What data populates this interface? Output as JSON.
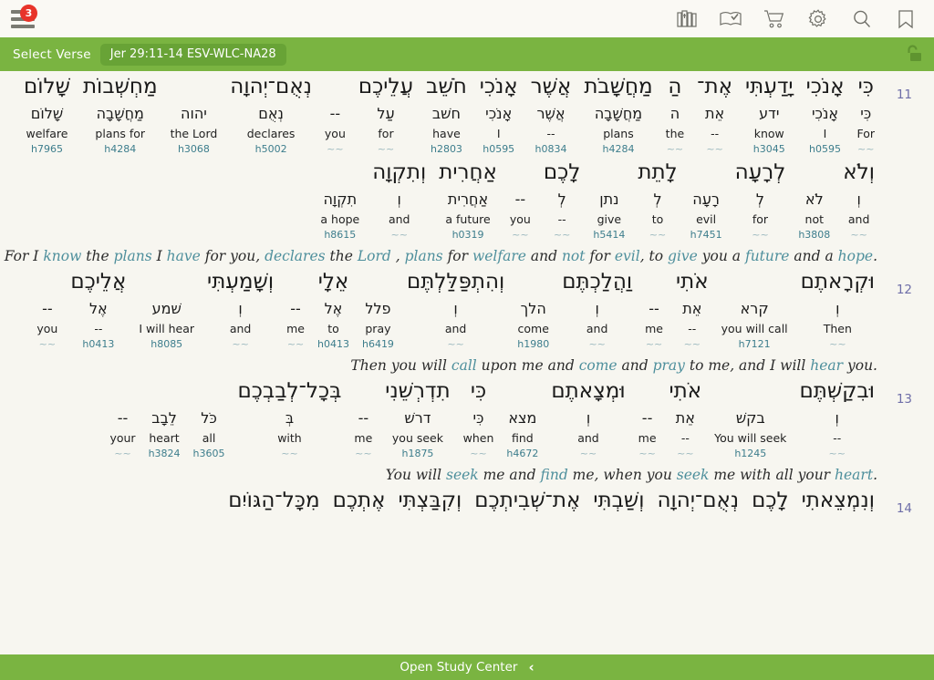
{
  "app": {
    "menu_badge_count": "3",
    "top_icons": [
      {
        "name": "library-books-icon",
        "label": "Library"
      },
      {
        "name": "open-book-check-icon",
        "label": "Reading Plan"
      },
      {
        "name": "shopping-cart-icon",
        "label": "Store"
      },
      {
        "name": "gear-icon",
        "label": "Settings"
      },
      {
        "name": "search-icon",
        "label": "Search"
      },
      {
        "name": "bookmark-icon",
        "label": "Bookmarks"
      }
    ]
  },
  "verse_bar": {
    "select_verse_label": "Select Verse",
    "reference_chip": "Jer 29:11-14 ESV-WLC-NA28",
    "lock_icon": "unlock-icon",
    "bar_color": "#7ab441",
    "chip_color": "#68a336"
  },
  "bottom_bar": {
    "label": "Open Study Center",
    "chevron": "‹"
  },
  "colors": {
    "page_bg": "#f7f6f0",
    "accent_green": "#7ab441",
    "verse_number": "#6e6ea8",
    "strongs": "#3d7d8c",
    "highlight": "#4e8f9c",
    "badge_red": "#e8342a"
  },
  "passage": {
    "verses": [
      {
        "number": "11",
        "rows": [
          {
            "words": [
              {
                "heb": "כִּי",
                "lemma": "כִּי",
                "gloss": "For",
                "strong": "~~"
              },
              {
                "heb": "אָנֹכִי",
                "lemma": "אָנֹכִי",
                "gloss": "I",
                "strong": "h0595"
              },
              {
                "heb": "יָדַעְתִּי",
                "lemma": "ידע",
                "gloss": "know",
                "strong": "h3045"
              },
              {
                "heb": "אֶת־",
                "lemma": "אֵת",
                "gloss": "--",
                "strong": "~~"
              },
              {
                "heb": "הַ",
                "lemma": "ה",
                "gloss": "the",
                "strong": "~~"
              },
              {
                "heb": "מַחֲשָׁבֹת",
                "lemma": "מַחֲשָׁבָה",
                "gloss": "plans",
                "strong": "h4284"
              },
              {
                "heb": "אֲשֶׁר",
                "lemma": "אֲשֶׁר",
                "gloss": "--",
                "strong": "h0834"
              },
              {
                "heb": "אָנֹכִי",
                "lemma": "אָנֹכִי",
                "gloss": "I",
                "strong": "h0595"
              },
              {
                "heb": "חֹשֵׁב",
                "lemma": "חשׁב",
                "gloss": "have",
                "strong": "h2803"
              },
              {
                "heb": "עֲלֵיכֶם",
                "lemma": "עַל",
                "gloss": "for",
                "strong": "~~"
              },
              {
                "heb": "",
                "lemma": "--",
                "gloss": "you",
                "strong": "~~"
              },
              {
                "heb": "נְאֻם־יְהוָה",
                "lemma": "נְאֻם",
                "gloss": "declares",
                "strong": "h5002"
              },
              {
                "heb": "",
                "lemma": "יהוה",
                "gloss": "the Lord",
                "strong": "h3068"
              },
              {
                "heb": "מַחְשְׁבוֹת",
                "lemma": "מַחֲשָׁבָה",
                "gloss": "plans for",
                "strong": "h4284"
              },
              {
                "heb": "שָׁלוֹם",
                "lemma": "שָׁלוֹם",
                "gloss": "welfare",
                "strong": "h7965"
              }
            ]
          },
          {
            "words": [
              {
                "heb": "וְלֹא",
                "lemma": "וְ",
                "gloss": "and",
                "strong": "~~"
              },
              {
                "heb": "",
                "lemma": "לֹא",
                "gloss": "not",
                "strong": "h3808"
              },
              {
                "heb": "לְרָעָה",
                "lemma": "לְ",
                "gloss": "for",
                "strong": "~~"
              },
              {
                "heb": "",
                "lemma": "רָעָה",
                "gloss": "evil",
                "strong": "h7451"
              },
              {
                "heb": "לָתֵת",
                "lemma": "לְ",
                "gloss": "to",
                "strong": "~~"
              },
              {
                "heb": "",
                "lemma": "נתן",
                "gloss": "give",
                "strong": "h5414"
              },
              {
                "heb": "לָכֶם",
                "lemma": "לְ",
                "gloss": "--",
                "strong": "~~"
              },
              {
                "heb": "",
                "lemma": "--",
                "gloss": "you",
                "strong": "~~"
              },
              {
                "heb": "אַחֲרִית",
                "lemma": "אַחֲרִית",
                "gloss": "a future",
                "strong": "h0319"
              },
              {
                "heb": "וְתִקְוָה",
                "lemma": "וְ",
                "gloss": "and",
                "strong": "~~"
              },
              {
                "heb": "",
                "lemma": "תִקְוָה",
                "gloss": "a hope",
                "strong": "h8615"
              }
            ]
          }
        ],
        "translation": [
          {
            "t": "For I ",
            "hl": false
          },
          {
            "t": "know",
            "hl": true
          },
          {
            "t": " the ",
            "hl": false
          },
          {
            "t": "plans",
            "hl": true
          },
          {
            "t": " I ",
            "hl": false
          },
          {
            "t": "have",
            "hl": true
          },
          {
            "t": " for you, ",
            "hl": false
          },
          {
            "t": "declares",
            "hl": true
          },
          {
            "t": " the ",
            "hl": false
          },
          {
            "t": "Lord",
            "hl": true
          },
          {
            "t": " , ",
            "hl": false
          },
          {
            "t": "plans",
            "hl": true
          },
          {
            "t": " for ",
            "hl": false
          },
          {
            "t": "welfare",
            "hl": true
          },
          {
            "t": " and ",
            "hl": false
          },
          {
            "t": "not",
            "hl": true
          },
          {
            "t": " for ",
            "hl": false
          },
          {
            "t": "evil",
            "hl": true
          },
          {
            "t": ", to ",
            "hl": false
          },
          {
            "t": "give",
            "hl": true
          },
          {
            "t": " you a ",
            "hl": false
          },
          {
            "t": "future",
            "hl": true
          },
          {
            "t": " and a ",
            "hl": false
          },
          {
            "t": "hope",
            "hl": true
          },
          {
            "t": ".",
            "hl": false
          }
        ]
      },
      {
        "number": "12",
        "rows": [
          {
            "words": [
              {
                "heb": "וּקְרָאתֶם",
                "lemma": "וְ",
                "gloss": "Then",
                "strong": "~~"
              },
              {
                "heb": "",
                "lemma": "קרא",
                "gloss": "you will call",
                "strong": "h7121"
              },
              {
                "heb": "אֹתִי",
                "lemma": "אֵת",
                "gloss": "--",
                "strong": "~~"
              },
              {
                "heb": "",
                "lemma": "--",
                "gloss": "me",
                "strong": "~~"
              },
              {
                "heb": "וַהֲלַכְתֶּם",
                "lemma": "וְ",
                "gloss": "and",
                "strong": "~~"
              },
              {
                "heb": "",
                "lemma": "הלך",
                "gloss": "come",
                "strong": "h1980"
              },
              {
                "heb": "וְהִתְפַּלַּלְתֶּם",
                "lemma": "וְ",
                "gloss": "and",
                "strong": "~~"
              },
              {
                "heb": "",
                "lemma": "פלל",
                "gloss": "pray",
                "strong": "h6419"
              },
              {
                "heb": "אֵלָי",
                "lemma": "אֶל",
                "gloss": "to",
                "strong": "h0413"
              },
              {
                "heb": "",
                "lemma": "--",
                "gloss": "me",
                "strong": "~~"
              },
              {
                "heb": "וְשָׁמַעְתִּי",
                "lemma": "וְ",
                "gloss": "and",
                "strong": "~~"
              },
              {
                "heb": "",
                "lemma": "שׁמע",
                "gloss": "I will hear",
                "strong": "h8085"
              },
              {
                "heb": "אֲלֵיכֶם",
                "lemma": "אֶל",
                "gloss": "--",
                "strong": "h0413"
              },
              {
                "heb": "",
                "lemma": "--",
                "gloss": "you",
                "strong": "~~"
              }
            ]
          }
        ],
        "translation": [
          {
            "t": "Then you will ",
            "hl": false
          },
          {
            "t": "call",
            "hl": true
          },
          {
            "t": " upon me and ",
            "hl": false
          },
          {
            "t": "come",
            "hl": true
          },
          {
            "t": " and ",
            "hl": false
          },
          {
            "t": "pray",
            "hl": true
          },
          {
            "t": " to me, and I will ",
            "hl": false
          },
          {
            "t": "hear",
            "hl": true
          },
          {
            "t": " you.",
            "hl": false
          }
        ]
      },
      {
        "number": "13",
        "rows": [
          {
            "words": [
              {
                "heb": "וּבִקַשְׁתֶּם",
                "lemma": "וְ",
                "gloss": "--",
                "strong": "~~"
              },
              {
                "heb": "",
                "lemma": "בקשׁ",
                "gloss": "You will seek",
                "strong": "h1245"
              },
              {
                "heb": "אֹתִי",
                "lemma": "אֵת",
                "gloss": "--",
                "strong": "~~"
              },
              {
                "heb": "",
                "lemma": "--",
                "gloss": "me",
                "strong": "~~"
              },
              {
                "heb": "וּמְצָאתֶם",
                "lemma": "וְ",
                "gloss": "and",
                "strong": "~~"
              },
              {
                "heb": "",
                "lemma": "מצא",
                "gloss": "find",
                "strong": "h4672"
              },
              {
                "heb": "כִּי",
                "lemma": "כִּי",
                "gloss": "when",
                "strong": "~~"
              },
              {
                "heb": "תִדְרְשֵׁנִי",
                "lemma": "דרשׁ",
                "gloss": "you seek",
                "strong": "h1875"
              },
              {
                "heb": "",
                "lemma": "--",
                "gloss": "me",
                "strong": "~~"
              },
              {
                "heb": "בְּכָל־לְבַבְכֶם",
                "lemma": "בְּ",
                "gloss": "with",
                "strong": "~~"
              },
              {
                "heb": "",
                "lemma": "כֹּל",
                "gloss": "all",
                "strong": "h3605"
              },
              {
                "heb": "",
                "lemma": "לֵבָב",
                "gloss": "heart",
                "strong": "h3824"
              },
              {
                "heb": "",
                "lemma": "--",
                "gloss": "your",
                "strong": "~~"
              }
            ]
          }
        ],
        "translation": [
          {
            "t": "You will ",
            "hl": false
          },
          {
            "t": "seek",
            "hl": true
          },
          {
            "t": " me and ",
            "hl": false
          },
          {
            "t": "find",
            "hl": true
          },
          {
            "t": " me, when you ",
            "hl": false
          },
          {
            "t": "seek",
            "hl": true
          },
          {
            "t": " me with all your ",
            "hl": false
          },
          {
            "t": "heart",
            "hl": true
          },
          {
            "t": ".",
            "hl": false
          }
        ]
      },
      {
        "number": "14",
        "rows": [
          {
            "words": [
              {
                "heb": "וְנִמְצֵאתִי",
                "lemma": "",
                "gloss": "",
                "strong": ""
              },
              {
                "heb": "לָכֶם",
                "lemma": "",
                "gloss": "",
                "strong": ""
              },
              {
                "heb": "נְאֻם־יְהוָה",
                "lemma": "",
                "gloss": "",
                "strong": ""
              },
              {
                "heb": "וְשַׁבְתִּי",
                "lemma": "",
                "gloss": "",
                "strong": ""
              },
              {
                "heb": "אֶת־שְׁׁבִיתְכֶם",
                "lemma": "",
                "gloss": "",
                "strong": ""
              },
              {
                "heb": "וְקִבַּצְתִּי",
                "lemma": "",
                "gloss": "",
                "strong": ""
              },
              {
                "heb": "אֶתְכֶם",
                "lemma": "",
                "gloss": "",
                "strong": ""
              },
              {
                "heb": "מִכָּל־הַגּוֹיִם",
                "lemma": "",
                "gloss": "",
                "strong": ""
              }
            ]
          }
        ],
        "translation": []
      }
    ]
  }
}
